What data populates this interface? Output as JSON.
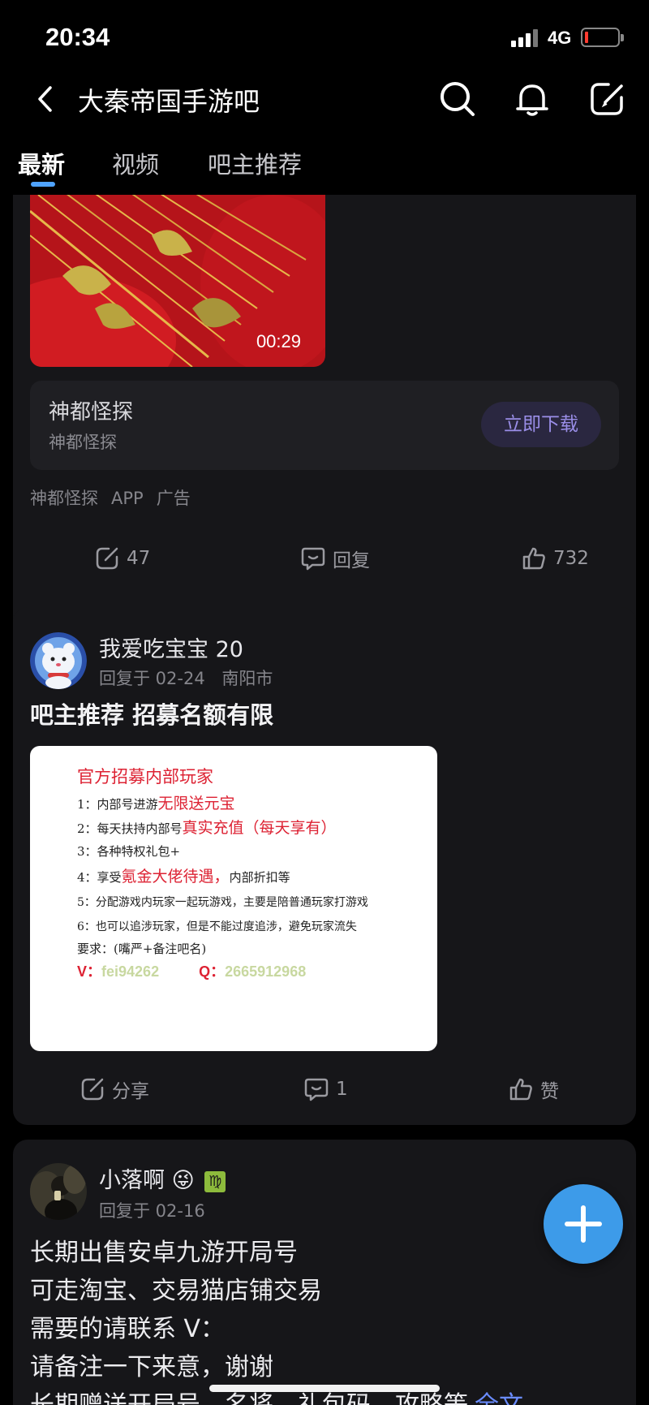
{
  "status_bar": {
    "time": "20:34",
    "network": "4G"
  },
  "header": {
    "title": "大秦帝国手游吧",
    "icons": [
      "back-icon",
      "search-icon",
      "bell-icon",
      "compose-icon"
    ]
  },
  "tabs": [
    {
      "label": "最新",
      "active": true
    },
    {
      "label": "视频",
      "active": false
    },
    {
      "label": "吧主推荐",
      "active": false
    }
  ],
  "ad_post": {
    "video_duration": "00:29",
    "app_name": "神都怪探",
    "app_subtitle": "神都怪探",
    "download_label": "立即下载",
    "tags": [
      "神都怪探",
      "APP",
      "广告"
    ],
    "share_count": "47",
    "reply_label": "回复",
    "like_count": "732"
  },
  "post1": {
    "username": "我爱吃宝宝 20",
    "reply_meta": "回复于 02-24",
    "location": "南阳市",
    "title": "吧主推荐 招募名额有限",
    "image_text": {
      "heading": "官方招募内部玩家",
      "lines": [
        {
          "pre": "1：内部号进游",
          "hl": "无限送元宝",
          "post": ""
        },
        {
          "pre": "2：每天扶持内部号",
          "hl": "真实充值（每天享有）",
          "post": ""
        },
        {
          "pre": "3：各种特权礼包+",
          "hl": "",
          "post": ""
        },
        {
          "pre": "4：享受",
          "hl": "氪金大佬待遇，",
          "post": "内部折扣等"
        },
        {
          "pre": "5：分配游戏内玩家一起玩游戏，主要是陪普通玩家打游戏",
          "hl": "",
          "post": ""
        },
        {
          "pre": "6：也可以追涉玩家，但是不能过度追涉，避免玩家流失",
          "hl": "",
          "post": ""
        },
        {
          "pre": "要求：(嘴严+备注吧名)",
          "hl": "",
          "post": ""
        }
      ],
      "v_label": "V：",
      "v_value": "fei94262",
      "q_label": "Q：",
      "q_value": "2665912968"
    },
    "share_label": "分享",
    "reply_count": "1",
    "like_label": "赞"
  },
  "post2": {
    "username": "小落啊",
    "emoji": "😜",
    "badge": "♍",
    "reply_meta": "回复于 02-16",
    "lines": [
      "长期出售安卓九游开局号",
      "可走淘宝、交易猫店铺交易",
      "需要的请联系 V：",
      "请备注一下来意，谢谢",
      "长期赠送开局号，名将，礼包码，攻略等"
    ],
    "more_label": "全文"
  },
  "colors": {
    "accent": "#4fa3ff",
    "fab": "#3d9be9",
    "card": "#161619",
    "background": "#000000"
  }
}
